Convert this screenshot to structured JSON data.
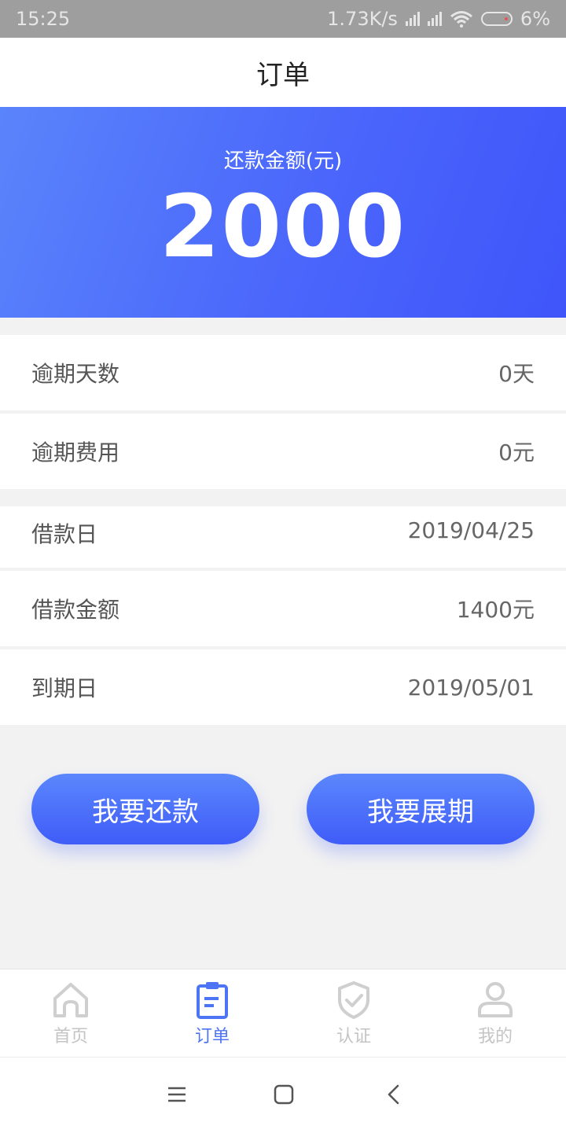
{
  "status_bar": {
    "time": "15:25",
    "net_speed": "1.73K/s",
    "battery": "6%"
  },
  "header": {
    "title": "订单"
  },
  "summary": {
    "label": "还款金额(元)",
    "amount": "2000"
  },
  "details": [
    {
      "label": "逾期天数",
      "value": "0天"
    },
    {
      "label": "逾期费用",
      "value": "0元"
    },
    {
      "label": "借款日",
      "value": "2019/04/25"
    },
    {
      "label": "借款金额",
      "value": "1400元"
    },
    {
      "label": "到期日",
      "value": "2019/05/01"
    }
  ],
  "actions": {
    "repay_label": "我要还款",
    "extend_label": "我要展期"
  },
  "tabs": [
    {
      "label": "首页",
      "icon": "home-icon"
    },
    {
      "label": "订单",
      "icon": "order-icon",
      "active": true
    },
    {
      "label": "认证",
      "icon": "shield-check-icon"
    },
    {
      "label": "我的",
      "icon": "user-icon"
    }
  ],
  "colors": {
    "accent": "#4d74f5",
    "hero_start": "#5a84fb",
    "hero_end": "#3f55fa"
  }
}
